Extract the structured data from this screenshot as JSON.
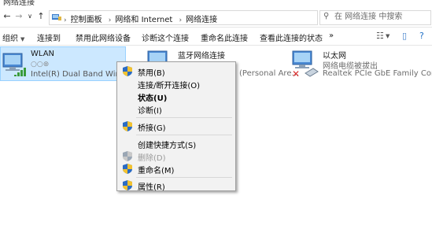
{
  "window": {
    "title": "网络连接"
  },
  "address": {
    "crumbs": [
      "控制面板",
      "网络和 Internet",
      "网络连接"
    ],
    "search_placeholder": "在 网络连接 中搜索"
  },
  "toolbar": {
    "items": [
      "组织",
      "连接到",
      "禁用此网络设备",
      "诊断这个连接",
      "重命名此连接",
      "查看此连接的状态",
      "»"
    ]
  },
  "connections": [
    {
      "name": "WLAN",
      "status": "",
      "device": "Intel(R) Dual Band Wireles..."
    },
    {
      "name": "蓝牙网络连接",
      "status": "",
      "device": "(Personal Are..."
    },
    {
      "name": "以太网",
      "status": "网络电缆被拔出",
      "device": "Realtek PCIe GbE Family Contr..."
    }
  ],
  "context_menu": {
    "items": [
      {
        "label": "禁用(B)",
        "shield": true,
        "bold": false,
        "disabled": false
      },
      {
        "label": "连接/断开连接(O)",
        "shield": false,
        "bold": false,
        "disabled": false
      },
      {
        "label": "状态(U)",
        "shield": false,
        "bold": true,
        "disabled": false
      },
      {
        "label": "诊断(I)",
        "shield": false,
        "bold": false,
        "disabled": false
      },
      {
        "label": "桥接(G)",
        "shield": true,
        "bold": false,
        "disabled": false
      },
      {
        "label": "创建快捷方式(S)",
        "shield": false,
        "bold": false,
        "disabled": false
      },
      {
        "label": "删除(D)",
        "shield": true,
        "bold": false,
        "disabled": true
      },
      {
        "label": "重命名(M)",
        "shield": true,
        "bold": false,
        "disabled": false
      },
      {
        "label": "属性(R)",
        "shield": true,
        "bold": false,
        "disabled": false
      }
    ]
  },
  "colors": {
    "selection": "#cce8ff",
    "selection_border": "#99d1ff",
    "menu_bg": "#f2f2f2"
  }
}
